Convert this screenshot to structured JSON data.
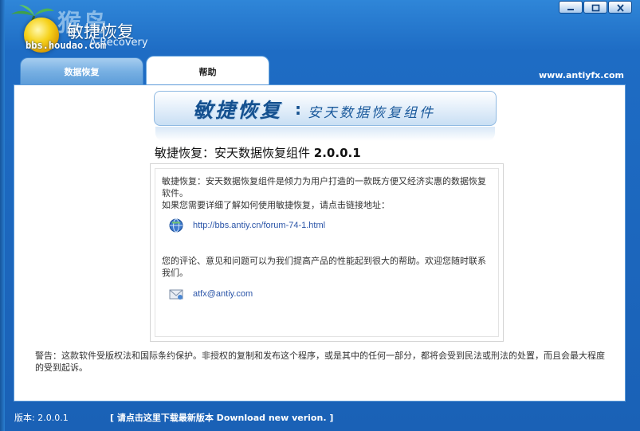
{
  "window": {
    "app_name": "敏捷恢复",
    "app_subtitle": "A-Recovery",
    "watermark_title": "猴岛",
    "watermark_url": "bbs.houdao.com"
  },
  "tabs": [
    {
      "label": "数据恢复",
      "active": false
    },
    {
      "label": "帮助",
      "active": true
    }
  ],
  "site_url": "www.antiyfx.com",
  "banner": {
    "main": "敏捷恢复",
    "colon": ":",
    "sub": "安天数据恢复组件"
  },
  "heading": {
    "name": "敏捷恢复：安天数据恢复组件",
    "version": "2.0.0.1"
  },
  "info": {
    "para1": "敏捷恢复：安天数据恢复组件是倾力为用户打造的一款既方便又经济实惠的数据恢复软件。",
    "para2": "如果您需要详细了解如何使用敏捷恢复，请点击链接地址：",
    "link_url": "http://bbs.antiy.cn/forum-74-1.html",
    "para3": "您的评论、意见和问题可以为我们提高产品的性能起到很大的帮助。欢迎您随时联系我们。",
    "email": "atfx@antiy.com"
  },
  "warning": "警告：这款软件受版权法和国际条约保护。非授权的复制和发布这个程序，或是其中的任何一部分，都将会受到民法或刑法的处置，而且会最大程度的受到起诉。",
  "status": {
    "version": "版本: 2.0.0.1",
    "update_link": "[ 请点击这里下载最新版本 Download new verion. ]"
  },
  "colors": {
    "window_blue": "#1e6cc4",
    "link_blue": "#2b55a8",
    "banner_text": "#14508f"
  }
}
